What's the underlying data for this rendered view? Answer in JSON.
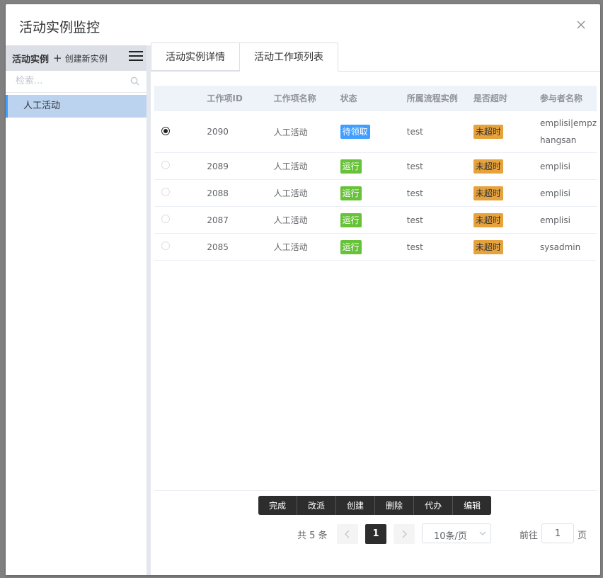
{
  "dialog": {
    "title": "活动实例监控"
  },
  "left": {
    "title": "活动实例",
    "create_label": "创建新实例",
    "search_placeholder": "检索...",
    "items": [
      {
        "label": "人工活动"
      }
    ]
  },
  "tabs": [
    {
      "label": "活动实例详情"
    },
    {
      "label": "活动工作项列表"
    }
  ],
  "table": {
    "headers": [
      "工作项ID",
      "工作项名称",
      "状态",
      "所属流程实例",
      "是否超时",
      "参与者名称"
    ],
    "rows": [
      {
        "id": "2090",
        "name": "人工活动",
        "status": "待领取",
        "instance": "test",
        "timeout": "未超时",
        "participant_line1": "emplisi|empz",
        "participant_line2": "hangsan"
      },
      {
        "id": "2089",
        "name": "人工活动",
        "status": "运行",
        "instance": "test",
        "timeout": "未超时",
        "participant_line1": "emplisi"
      },
      {
        "id": "2088",
        "name": "人工活动",
        "status": "运行",
        "instance": "test",
        "timeout": "未超时",
        "participant_line1": "emplisi"
      },
      {
        "id": "2087",
        "name": "人工活动",
        "status": "运行",
        "instance": "test",
        "timeout": "未超时",
        "participant_line1": "emplisi"
      },
      {
        "id": "2085",
        "name": "人工活动",
        "status": "运行",
        "instance": "test",
        "timeout": "未超时",
        "participant_line1": "sysadmin"
      }
    ]
  },
  "actions": [
    "完成",
    "改派",
    "创建",
    "删除",
    "代办",
    "编辑"
  ],
  "pager": {
    "total": "共 5 条",
    "current": "1",
    "page_size": "10条/页",
    "goto_label": "前往",
    "goto_value": "1",
    "page_unit": "页"
  },
  "colors": {
    "status_wait": "#409eff",
    "status_run": "#67c23a",
    "timeout": "#e6a23c",
    "dark": "#2d2d2d"
  }
}
